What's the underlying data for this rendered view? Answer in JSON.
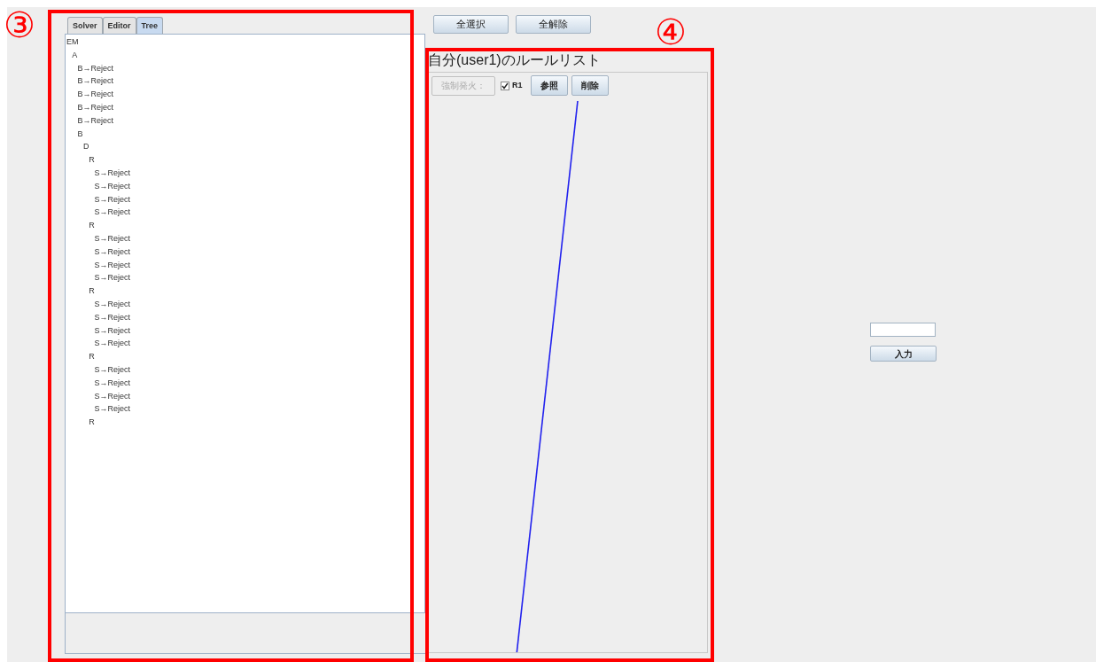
{
  "tabs": [
    {
      "label": "Solver",
      "selected": false
    },
    {
      "label": "Editor",
      "selected": false
    },
    {
      "label": "Tree",
      "selected": true
    }
  ],
  "tree": {
    "label": "EM",
    "children": [
      {
        "label": "A",
        "children": [
          {
            "label": "B→Reject"
          },
          {
            "label": "B→Reject"
          },
          {
            "label": "B→Reject"
          },
          {
            "label": "B→Reject"
          },
          {
            "label": "B→Reject"
          },
          {
            "label": "B",
            "children": [
              {
                "label": "D",
                "children": [
                  {
                    "label": "R",
                    "children": [
                      {
                        "label": "S→Reject"
                      },
                      {
                        "label": "S→Reject"
                      },
                      {
                        "label": "S→Reject"
                      },
                      {
                        "label": "S→Reject"
                      }
                    ]
                  },
                  {
                    "label": "R",
                    "children": [
                      {
                        "label": "S→Reject"
                      },
                      {
                        "label": "S→Reject"
                      },
                      {
                        "label": "S→Reject"
                      },
                      {
                        "label": "S→Reject"
                      }
                    ]
                  },
                  {
                    "label": "R",
                    "children": [
                      {
                        "label": "S→Reject"
                      },
                      {
                        "label": "S→Reject"
                      },
                      {
                        "label": "S→Reject"
                      },
                      {
                        "label": "S→Reject"
                      }
                    ]
                  },
                  {
                    "label": "R",
                    "children": [
                      {
                        "label": "S→Reject"
                      },
                      {
                        "label": "S→Reject"
                      },
                      {
                        "label": "S→Reject"
                      },
                      {
                        "label": "S→Reject"
                      }
                    ]
                  },
                  {
                    "label": "R"
                  }
                ]
              }
            ]
          }
        ]
      }
    ]
  },
  "top_buttons": [
    "全選択",
    "全解除"
  ],
  "rule_list": {
    "title": "自分(user1)のルールリスト",
    "fire_button": {
      "label": "強制発火：",
      "disabled": true
    },
    "rule": {
      "label": "R1",
      "checked": true
    },
    "buttons": [
      "参照",
      "削除"
    ]
  },
  "side": {
    "button": "入力"
  },
  "annotations": [
    {
      "label": "③"
    },
    {
      "label": "④"
    }
  ]
}
